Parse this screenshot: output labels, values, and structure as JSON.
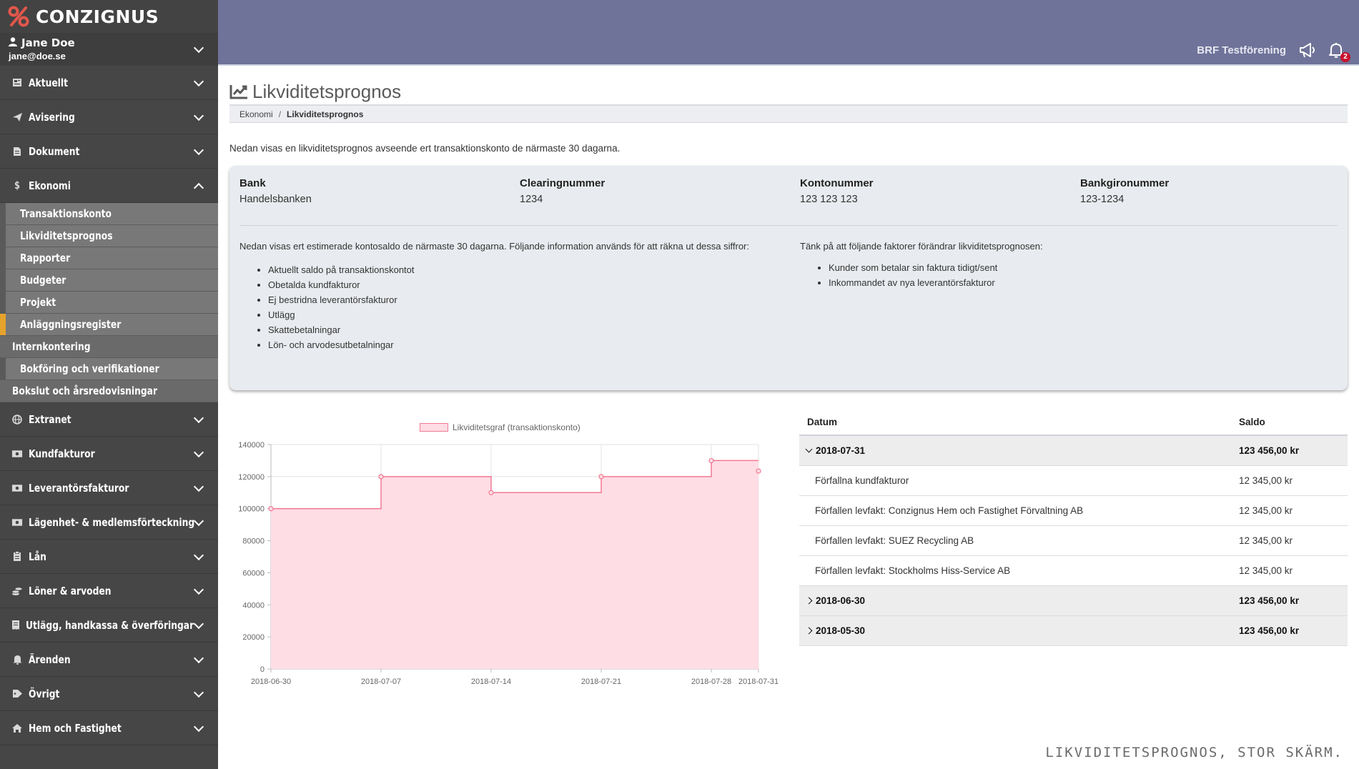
{
  "brand": {
    "name": "CONZIGNUS"
  },
  "user": {
    "name": "Jane Doe",
    "email": "jane@doe.se"
  },
  "sidebar": {
    "top_items": [
      {
        "label": "Aktuellt",
        "icon": "news-icon"
      },
      {
        "label": "Avisering",
        "icon": "paper-plane-icon"
      },
      {
        "label": "Dokument",
        "icon": "document-icon"
      },
      {
        "label": "Ekonomi",
        "icon": "dollar-icon"
      }
    ],
    "ekonomi_sub": [
      {
        "label": "Transaktionskonto"
      },
      {
        "label": "Likviditetsprognos"
      },
      {
        "label": "Rapporter"
      },
      {
        "label": "Budgeter"
      },
      {
        "label": "Projekt"
      },
      {
        "label": "Anläggningsregister"
      },
      {
        "label": "Internkontering"
      },
      {
        "label": "Bokföring och verifikationer"
      },
      {
        "label": "Bokslut och årsredovisningar"
      }
    ],
    "bottom_items": [
      {
        "label": "Extranet",
        "icon": "globe-icon"
      },
      {
        "label": "Kundfakturor",
        "icon": "money-bill-icon"
      },
      {
        "label": "Leverantörsfakturor",
        "icon": "money-bill-icon"
      },
      {
        "label": "Lägenhet- & medlemsförteckning",
        "icon": "money-bill-icon"
      },
      {
        "label": "Lån",
        "icon": "clipboard-icon"
      },
      {
        "label": "Löner & arvoden",
        "icon": "coins-icon"
      },
      {
        "label": "Utlägg, handkassa & överföringar",
        "icon": "receipt-icon"
      },
      {
        "label": "Ärenden",
        "icon": "bell-icon"
      },
      {
        "label": "Övrigt",
        "icon": "tag-icon"
      },
      {
        "label": "Hem och Fastighet",
        "icon": "home-icon"
      }
    ]
  },
  "header": {
    "org_name": "BRF Testförening",
    "notification_count": "2"
  },
  "page": {
    "title": "Likviditetsprognos",
    "breadcrumb": {
      "parent": "Ekonomi",
      "current": "Likviditetsprognos"
    },
    "intro": "Nedan visas en likviditetsprognos avseende ert transaktionskonto de närmaste 30 dagarna."
  },
  "account": {
    "bank_label": "Bank",
    "bank": "Handelsbanken",
    "clearing_label": "Clearingnummer",
    "clearing": "1234",
    "konto_label": "Kontonummer",
    "konto": "123 123 123",
    "bankgiro_label": "Bankgironummer",
    "bankgiro": "123-1234"
  },
  "info": {
    "left_text": "Nedan visas ert estimerade kontosaldo de närmaste 30 dagarna. Följande information används för att räkna ut dessa siffror:",
    "left_list": [
      "Aktuellt saldo på transaktionskontot",
      "Obetalda kundfakturor",
      "Ej bestridna leverantörsfakturor",
      "Utlägg",
      "Skattebetalningar",
      "Lön- och arvodesutbetalningar"
    ],
    "right_text": "Tänk på att följande faktorer förändrar likviditetsprognosen:",
    "right_list": [
      "Kunder som betalar sin faktura tidigt/sent",
      "Inkommandet av nya leverantörsfakturor"
    ]
  },
  "chart_data": {
    "type": "line",
    "title": "",
    "legend": "Likviditetsgraf (transaktionskonto)",
    "legend_position": "top-center",
    "stepped": true,
    "filled": true,
    "fill_color": "#ffdde4",
    "line_color": "#f07a93",
    "x_ticks": [
      "2018-06-30",
      "2018-07-07",
      "2018-07-14",
      "2018-07-21",
      "2018-07-28",
      "2018-07-31"
    ],
    "y_ticks": [
      0,
      20000,
      40000,
      60000,
      80000,
      100000,
      120000,
      140000
    ],
    "ylim": [
      0,
      140000
    ],
    "grid": true,
    "series": [
      {
        "name": "Likviditetsgraf (transaktionskonto)",
        "points": [
          {
            "x": "2018-06-30",
            "y": 100000
          },
          {
            "x": "2018-07-07",
            "y": 120000
          },
          {
            "x": "2018-07-14",
            "y": 110000
          },
          {
            "x": "2018-07-21",
            "y": 120000
          },
          {
            "x": "2018-07-28",
            "y": 130000
          },
          {
            "x": "2018-07-31",
            "y": 123456
          }
        ]
      }
    ]
  },
  "table": {
    "col_date": "Datum",
    "col_saldo": "Saldo",
    "groups": [
      {
        "date": "2018-07-31",
        "saldo": "123 456,00 kr",
        "expanded": true,
        "rows": [
          {
            "label": "Förfallna kundfakturor",
            "saldo": "12 345,00 kr"
          },
          {
            "label": "Förfallen levfakt: Conzignus Hem och Fastighet Förvaltning AB",
            "saldo": "12 345,00 kr"
          },
          {
            "label": "Förfallen levfakt: SUEZ Recycling AB",
            "saldo": "12 345,00 kr"
          },
          {
            "label": "Förfallen levfakt: Stockholms Hiss-Service AB",
            "saldo": "12 345,00 kr"
          }
        ]
      },
      {
        "date": "2018-06-30",
        "saldo": "123 456,00 kr",
        "expanded": false,
        "rows": []
      },
      {
        "date": "2018-05-30",
        "saldo": "123 456,00 kr",
        "expanded": false,
        "rows": []
      }
    ]
  },
  "caption": "LIKVIDITETSPROGNOS, STOR SKÄRM."
}
